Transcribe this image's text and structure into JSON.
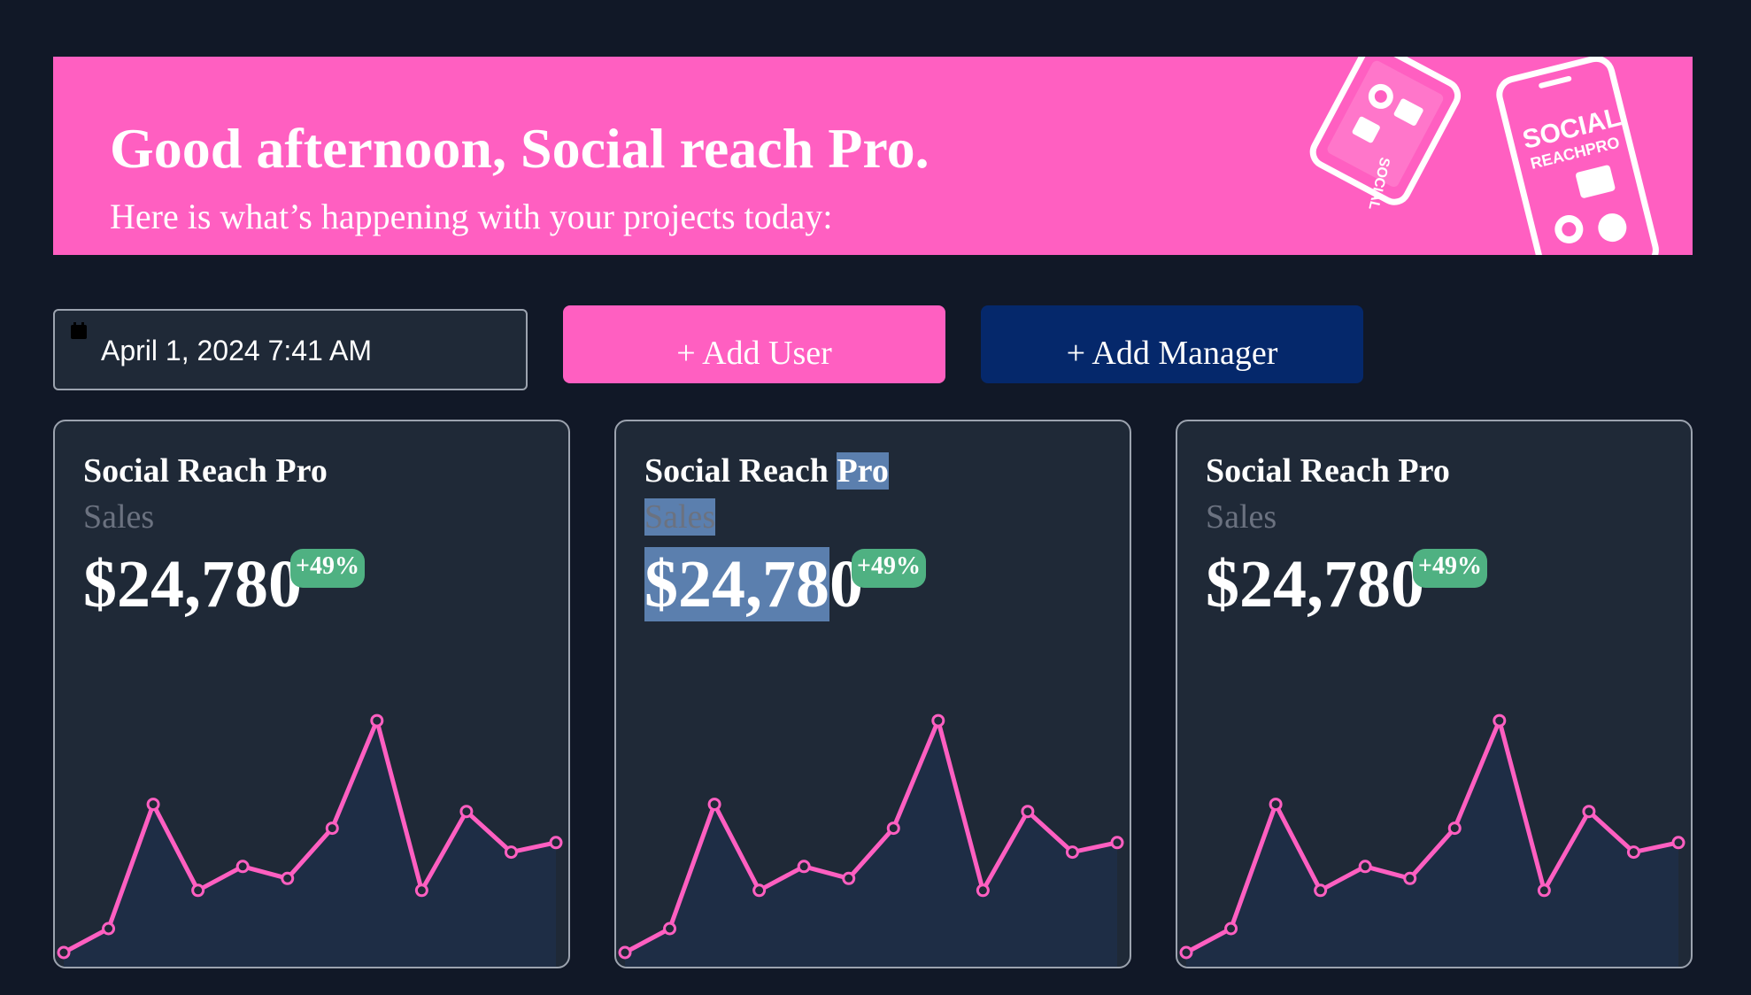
{
  "banner": {
    "title": "Good afternoon, Social reach Pro.",
    "subtitle": "Here is what’s happening with your projects today:",
    "background": "#ff5fc1",
    "art_icons": [
      "phone-illustration-icon",
      "phone-illustration-icon"
    ]
  },
  "toolbar": {
    "date_icon": "calendar-icon",
    "date_value": "April 1, 2024 7:41 AM",
    "add_user_label": "+ Add User",
    "add_manager_label": "+ Add Manager",
    "add_user_color": "#ff5fc1",
    "add_manager_color": "#05286b"
  },
  "cards": [
    {
      "title": "Social Reach Pro",
      "metric": "Sales",
      "value": "$24,780",
      "change": "+49%"
    },
    {
      "title_a": "Social Reach ",
      "title_b": "Pro",
      "metric": "Sales",
      "value_a": "$24,78",
      "value_b": "0",
      "change": "+49%"
    },
    {
      "title": "Social Reach Pro",
      "metric": "Sales",
      "value": "$24,780",
      "change": "+49%"
    }
  ],
  "colors": {
    "page_background": "#111827",
    "card_background": "#1f2937",
    "line": "#ff5fc1",
    "area_fill": "#1e2d45",
    "badge": "#4fb182",
    "selection": "#5b7fae"
  },
  "chart_data": {
    "type": "area",
    "series": [
      {
        "values": [
          0,
          0.1,
          0.62,
          0.26,
          0.36,
          0.31,
          0.52,
          0.97,
          0.26,
          0.59,
          0.42,
          0.46
        ]
      }
    ]
  }
}
